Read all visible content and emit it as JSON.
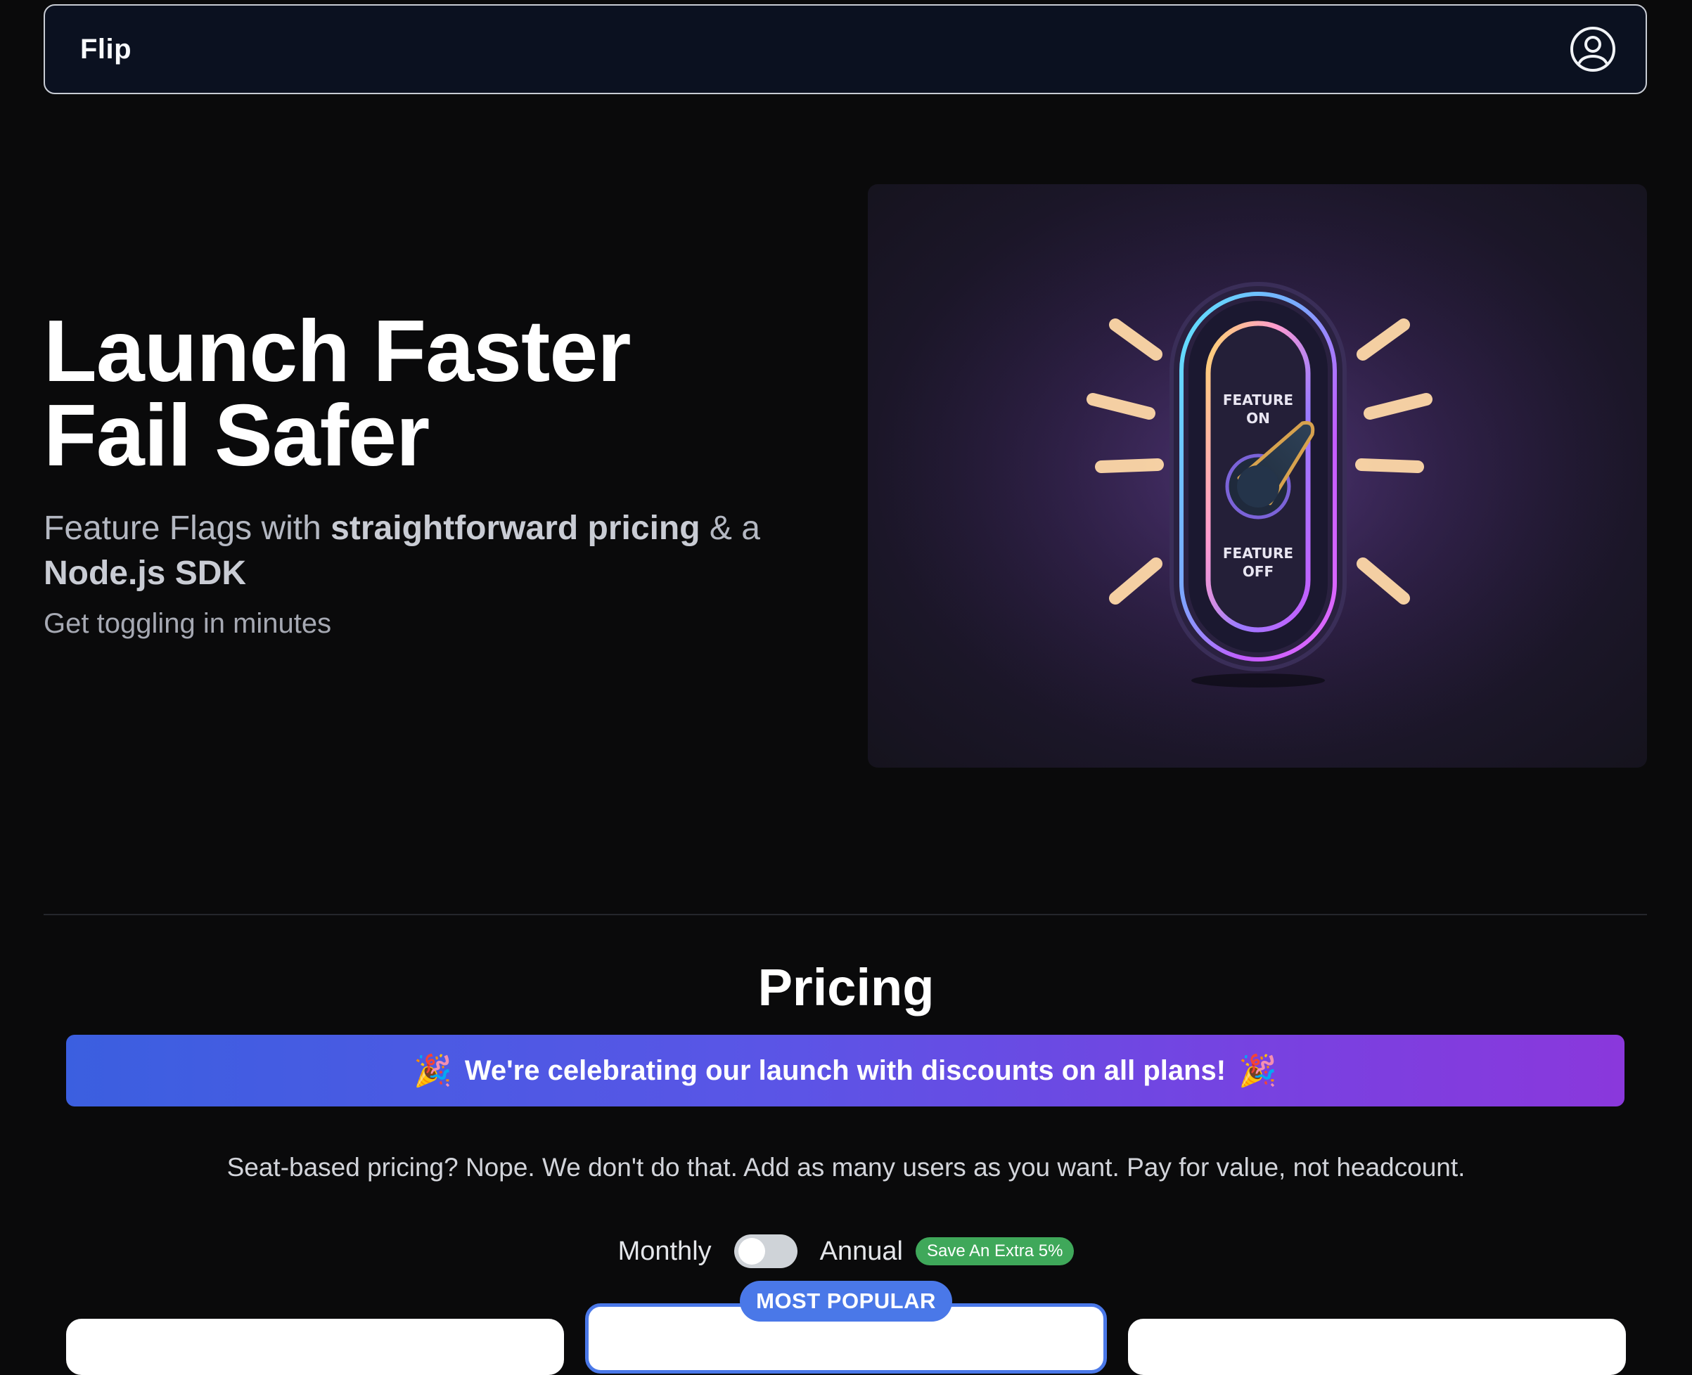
{
  "header": {
    "brand": "Flip",
    "account_icon": "user-circle-icon"
  },
  "hero": {
    "title_line1": "Launch Faster",
    "title_line2": "Fail Safer",
    "sub_prefix": "Feature Flags with ",
    "sub_bold1": "straightforward pricing",
    "sub_mid": " & a",
    "sub_bold2": "Node.js SDK",
    "tagline": "Get toggling in minutes",
    "image": {
      "label_on_1": "FEATURE",
      "label_on_2": "ON",
      "label_off_1": "FEATURE",
      "label_off_2": "OFF"
    }
  },
  "pricing": {
    "title": "Pricing",
    "banner": {
      "emoji": "🎉",
      "text": "We're celebrating our launch with discounts on all plans!"
    },
    "description": "Seat-based pricing? Nope. We don't do that. Add as many users as you want. Pay for value, not headcount.",
    "toggle": {
      "monthly_label": "Monthly",
      "annual_label": "Annual",
      "selected": "Monthly",
      "save_badge": "Save An Extra 5%"
    },
    "popular_label": "MOST POPULAR"
  },
  "colors": {
    "background": "#0a0a0b",
    "accent_blue": "#4a78e8",
    "banner_start": "#3b5fe0",
    "banner_end": "#8a38dc",
    "badge_green": "#3fa85a"
  }
}
